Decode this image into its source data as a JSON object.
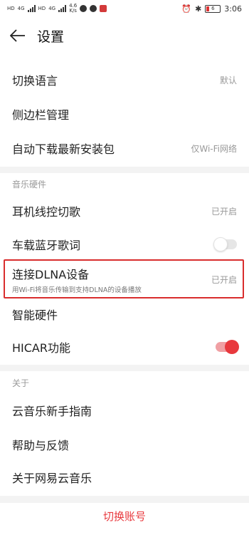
{
  "statusbar": {
    "hd1": "HD",
    "hd2": "HD",
    "net1": "4G",
    "net2": "4G",
    "speed_value": "4.6",
    "speed_unit": "K/s",
    "battery": "6",
    "time": "3:06",
    "icons": [
      "signal-icon",
      "signal-icon",
      "wechat-icon",
      "qq-icon",
      "app-icon",
      "alarm-icon",
      "bluetooth-icon",
      "battery-icon"
    ]
  },
  "header": {
    "title": "设置",
    "back_icon": "arrow-left-icon"
  },
  "general": [
    {
      "label": "切换语言",
      "value": "默认"
    },
    {
      "label": "侧边栏管理",
      "value": ""
    },
    {
      "label": "自动下载最新安装包",
      "value": "仅Wi-Fi网络"
    }
  ],
  "hardware": {
    "title": "音乐硬件",
    "items": [
      {
        "label": "耳机线控切歌",
        "value": "已开启"
      },
      {
        "label": "车载蓝牙歌词",
        "toggle": "off"
      },
      {
        "label": "连接DLNA设备",
        "sub": "用Wi-Fi将音乐传输到支持DLNA的设备播放",
        "value": "已开启"
      },
      {
        "label": "智能硬件",
        "value": ""
      },
      {
        "label": "HICAR功能",
        "toggle": "on"
      }
    ]
  },
  "about": {
    "title": "关于",
    "items": [
      {
        "label": "云音乐新手指南"
      },
      {
        "label": "帮助与反馈"
      },
      {
        "label": "关于网易云音乐"
      }
    ]
  },
  "bottom_action": "切换账号",
  "colors": {
    "accent": "#e8383d",
    "highlight_border": "#d92d2d"
  }
}
